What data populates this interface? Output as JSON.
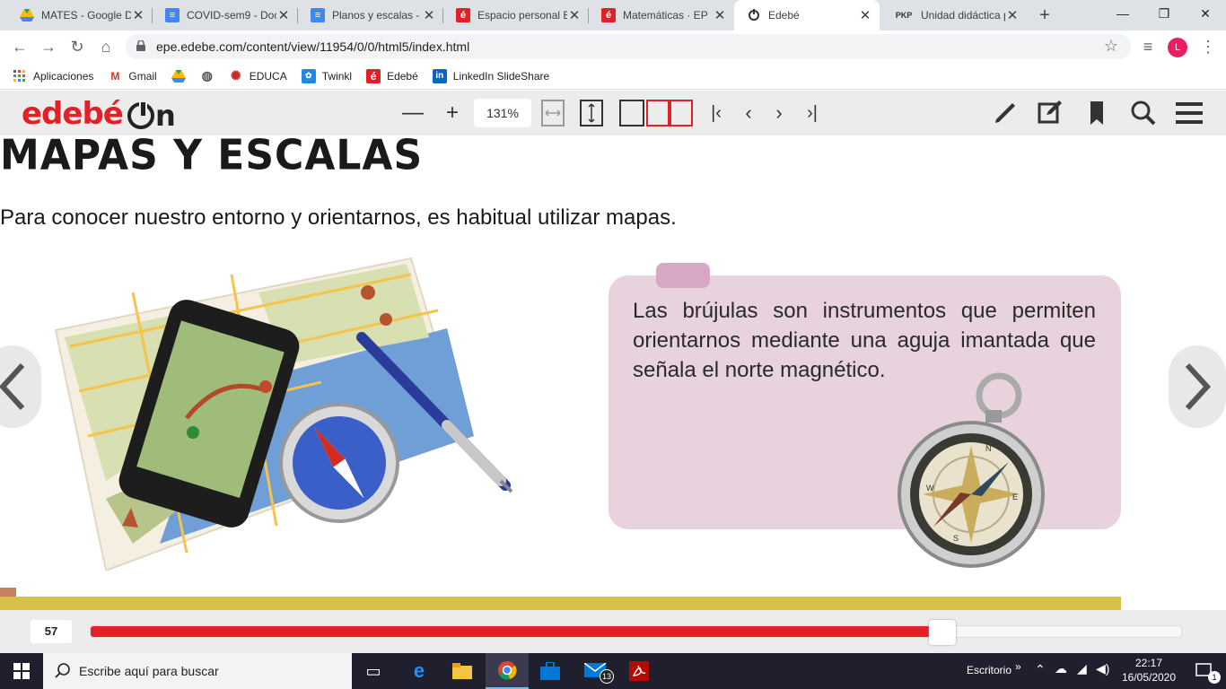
{
  "browser": {
    "tabs": [
      {
        "title": "MATES - Google D",
        "favicon": "google-drive-icon",
        "color": "#1fa463"
      },
      {
        "title": "COVID-sem9 - Doc",
        "favicon": "google-docs-icon",
        "color": "#4285f4"
      },
      {
        "title": "Planos y escalas - ",
        "favicon": "google-docs-icon",
        "color": "#4285f4"
      },
      {
        "title": "Espacio personal E",
        "favicon": "edebe-icon",
        "color": "#e32028"
      },
      {
        "title": "Matemáticas · EP",
        "favicon": "edebe-icon",
        "color": "#e32028"
      },
      {
        "title": "Edebé",
        "favicon": "edebe-on-icon",
        "color": "#333333"
      },
      {
        "title": "Unidad didáctica p",
        "favicon": "pkp-icon",
        "color": "#444444"
      }
    ],
    "active_tab_index": 5,
    "new_tab_label": "+",
    "url": "epe.edebe.com/content/view/11954/0/0/html5/index.html",
    "profile_initial": "L",
    "bookmarks": [
      {
        "label": "Aplicaciones",
        "icon": "apps-grid-icon"
      },
      {
        "label": "Gmail",
        "icon": "gmail-icon"
      },
      {
        "label": "",
        "icon": "google-drive-icon"
      },
      {
        "label": "",
        "icon": "globe-icon"
      },
      {
        "label": "EDUCA",
        "icon": "educa-icon"
      },
      {
        "label": "Twinkl",
        "icon": "twinkl-icon"
      },
      {
        "label": "Edebé",
        "icon": "edebe-icon"
      },
      {
        "label": "LinkedIn SlideShare",
        "icon": "linkedin-icon"
      }
    ]
  },
  "reader": {
    "brand": "edebé",
    "brand_suffix": "n",
    "zoom": "131%",
    "page_number": "57",
    "progress_fraction": 0.77
  },
  "page": {
    "heading": "MAPAS Y ESCALAS",
    "intro": "Para conocer nuestro entorno y orientarnos, es habitual utilizar mapas.",
    "info_text": "Las brújulas son instrumentos que permiten orientarnos mediante una aguja imantada que señala el norte magnético.",
    "compass_letters": {
      "n": "N",
      "e": "E",
      "s": "S",
      "w": "W"
    },
    "colors": {
      "accent": "#e32028",
      "info_box": "#e7d2de",
      "band": "#d9c049"
    }
  },
  "taskbar": {
    "search_placeholder": "Escribe aquí para buscar",
    "desktop_label": "Escritorio",
    "mail_badge": "13",
    "time": "22:17",
    "date": "16/05/2020",
    "notifications": "1"
  }
}
